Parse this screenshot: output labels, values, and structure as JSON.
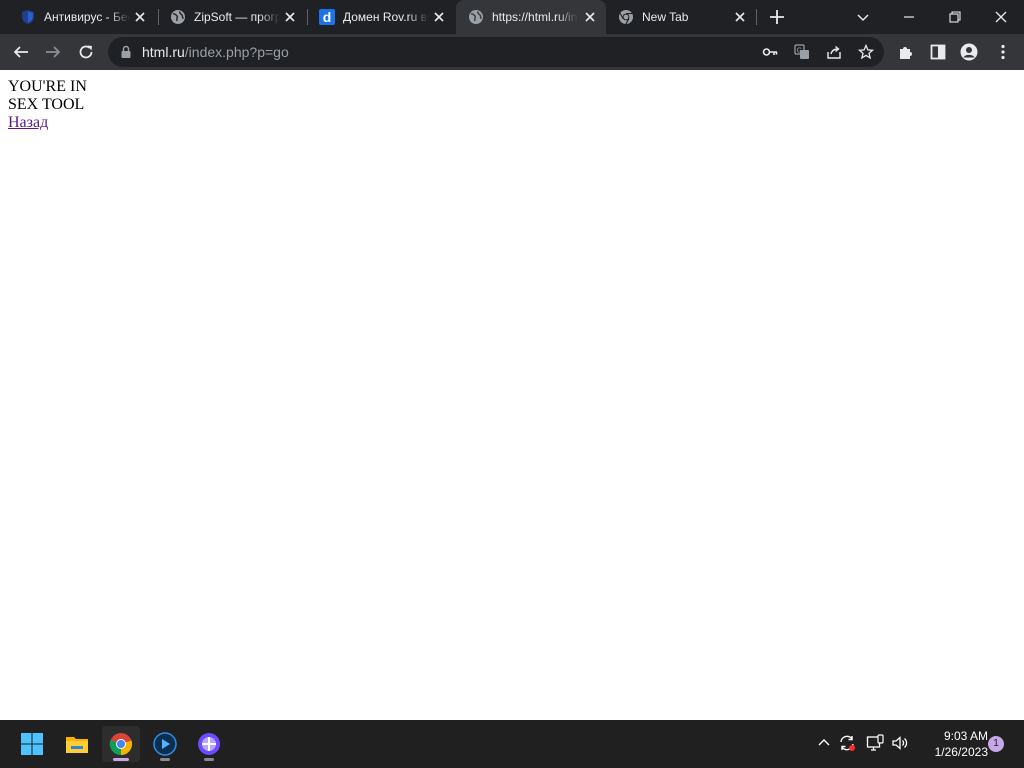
{
  "browser": {
    "tabs": [
      {
        "title": "Антивирус - Бесплатный",
        "favicon": "shield-icon",
        "active": false
      },
      {
        "title": "ZipSoft — программы",
        "favicon": "globe-icon",
        "active": false
      },
      {
        "title": "Домен Rov.ru выставлен",
        "favicon": "d-logo-icon",
        "active": false
      },
      {
        "title": "https://html.ru/index.php?p=go",
        "favicon": "globe-icon",
        "active": true
      },
      {
        "title": "New Tab",
        "favicon": "chrome-icon",
        "active": false
      }
    ],
    "address": {
      "host": "html.ru",
      "path": "/index.php?p=go"
    }
  },
  "page": {
    "line1": "YOU'RE IN",
    "line2": "SEX TOOL",
    "back_link": "Назад"
  },
  "taskbar": {
    "apps": [
      "start-icon",
      "file-explorer-icon",
      "chrome-icon",
      "media-player-icon",
      "proton-app-icon"
    ],
    "time": "9:03 AM",
    "date": "1/26/2023",
    "notification_count": "1"
  },
  "colors": {
    "tabstrip_bg": "#202124",
    "toolbar_bg": "#35363a",
    "omnibox_bg": "#202124",
    "link_visited": "#551a8b",
    "taskbar_bg": "#202020",
    "accent": "#c7a7e6"
  }
}
